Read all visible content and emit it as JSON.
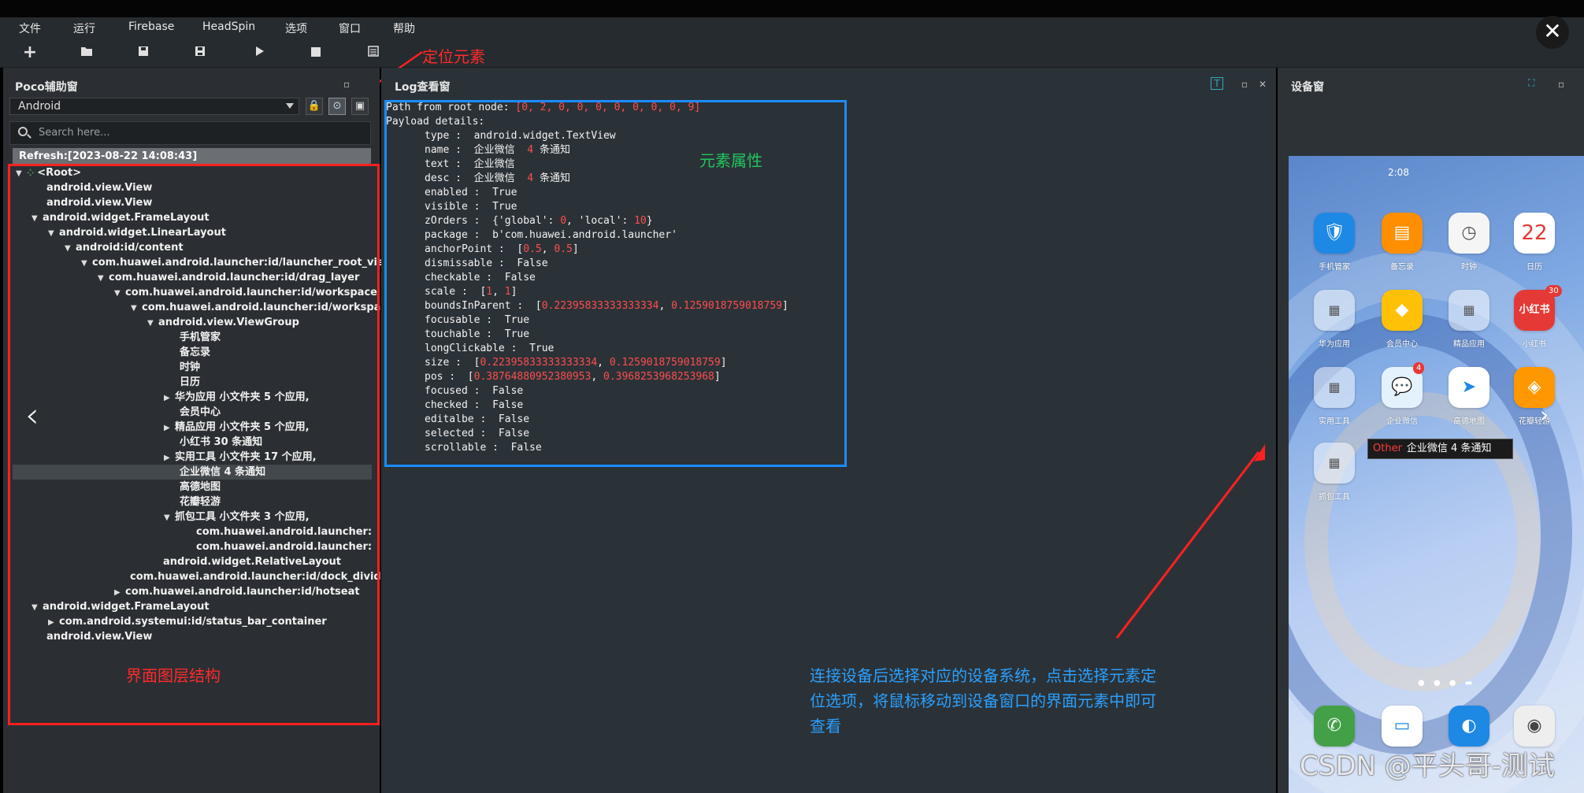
{
  "menu": [
    "文件",
    "运行",
    "Firebase",
    "HeadSpin",
    "选项",
    "窗口",
    "帮助"
  ],
  "toolbar_icons": [
    "add-icon",
    "open-folder-icon",
    "save-icon",
    "save-as-icon",
    "play-icon",
    "stop-icon",
    "list-icon"
  ],
  "annotations": {
    "locate_element": "定位元素",
    "element_props": "元素属性",
    "ui_hierarchy": "界面图层结构",
    "instructions": "连接设备后选择对应的设备系统，点击选择元素定位选项，将鼠标移动到设备窗口的界面元素中即可查看"
  },
  "poco": {
    "title": "Poco辅助窗",
    "platform": "Android",
    "search_placeholder": "Search here...",
    "refresh": "Refresh:[2023-08-22 14:08:43]",
    "tree": [
      "<Root>",
      "android.view.View",
      "android.view.View",
      "android.widget.FrameLayout",
      "android.widget.LinearLayout",
      "android:id/content",
      "com.huawei.android.launcher:id/launcher_root_view",
      "com.huawei.android.launcher:id/drag_layer",
      "com.huawei.android.launcher:id/workspace",
      "com.huawei.android.launcher:id/workspace_",
      "android.view.ViewGroup",
      "手机管家",
      "备忘录",
      "时钟",
      "日历",
      "华为应用 小文件夹 5 个应用,",
      "会员中心",
      "精品应用 小文件夹 5 个应用,",
      "小红书  30 条通知",
      "实用工具 小文件夹 17 个应用,",
      "企业微信  4 条通知",
      "高德地图",
      "花瓣轻游",
      "抓包工具 小文件夹 3 个应用,",
      "com.huawei.android.launcher:id/p",
      "com.huawei.android.launcher:id/fc",
      "android.widget.RelativeLayout",
      "com.huawei.android.launcher:id/dock_divider",
      "com.huawei.android.launcher:id/hotseat",
      "android.widget.FrameLayout",
      "com.android.systemui:id/status_bar_container",
      "android.view.View"
    ]
  },
  "log": {
    "title": "Log查看窗",
    "path_label": "Path from root node: ",
    "path_values": "[0, 2, 0, 0, 0, 0, 0, 0, 0, 9]",
    "payload_label": "Payload details:",
    "type": "android.widget.TextView",
    "name": "企业微信",
    "name_count": "4",
    "name_suffix": "条通知",
    "text": "企业微信",
    "desc": "企业微信",
    "desc_count": "4",
    "desc_suffix": "条通知",
    "enabled": "True",
    "visible": "True",
    "zOrders_global": "0",
    "zOrders_local": "10",
    "package": "b'com.huawei.android.launcher'",
    "anchorPoint": [
      "0.5",
      "0.5"
    ],
    "dismissable": "False",
    "checkable": "False",
    "scale": [
      "1",
      "1"
    ],
    "boundsInParent": [
      "0.22395833333333334",
      "0.1259018759018759"
    ],
    "focusable": "True",
    "touchable": "True",
    "longClickable": "True",
    "size": [
      "0.22395833333333334",
      "0.1259018759018759"
    ],
    "pos": [
      "0.38764880952380953",
      "0.3968253968253968"
    ],
    "focused": "False",
    "checked": "False",
    "editalbe": "False",
    "selected": "False",
    "scrollable": "False"
  },
  "device": {
    "title": "设备窗",
    "status_time": "2:08",
    "tooltip_type": "Other",
    "tooltip_text": "企业微信  4 条通知",
    "apps": [
      {
        "label": "手机管家"
      },
      {
        "label": "备忘录"
      },
      {
        "label": "时钟"
      },
      {
        "label": "日历",
        "glyph": "22",
        "sub": "星期二"
      },
      {
        "label": "华为应用"
      },
      {
        "label": "会员中心"
      },
      {
        "label": "精品应用"
      },
      {
        "label": "小红书",
        "glyph": "小红书",
        "badge": "30"
      },
      {
        "label": "实用工具"
      },
      {
        "label": "企业微信",
        "badge": "4"
      },
      {
        "label": "高德地图"
      },
      {
        "label": "花瓣轻游"
      },
      {
        "label": "抓包工具"
      }
    ]
  },
  "watermark": "CSDN @平头哥-测试"
}
